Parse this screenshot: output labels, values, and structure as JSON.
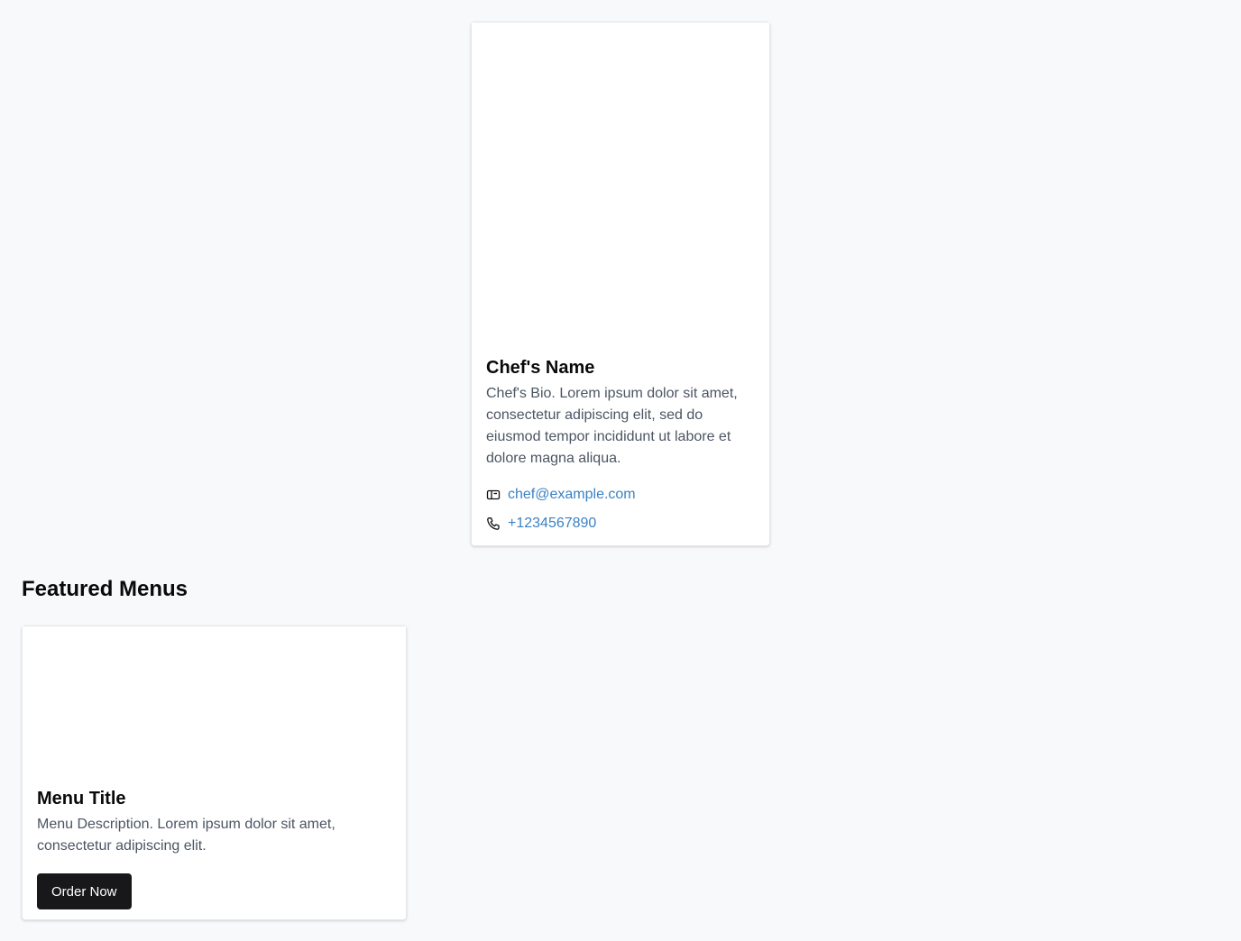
{
  "chef": {
    "name": "Chef's Name",
    "bio": "Chef's Bio. Lorem ipsum dolor sit amet, consectetur adipiscing elit, sed do eiusmod tempor incididunt ut labore et dolore magna aliqua.",
    "email": "chef@example.com",
    "phone": "+1234567890",
    "email_icon": "mail-icon",
    "phone_icon": "phone-icon"
  },
  "featured": {
    "title": "Featured Menus",
    "menus": [
      {
        "title": "Menu Title",
        "description": "Menu Description. Lorem ipsum dolor sit amet, consectetur adipiscing elit.",
        "button_label": "Order Now"
      }
    ]
  },
  "colors": {
    "background": "#f8f9fa",
    "link": "#3b82c4",
    "button": "#18181b",
    "muted_text": "#4b5563"
  }
}
